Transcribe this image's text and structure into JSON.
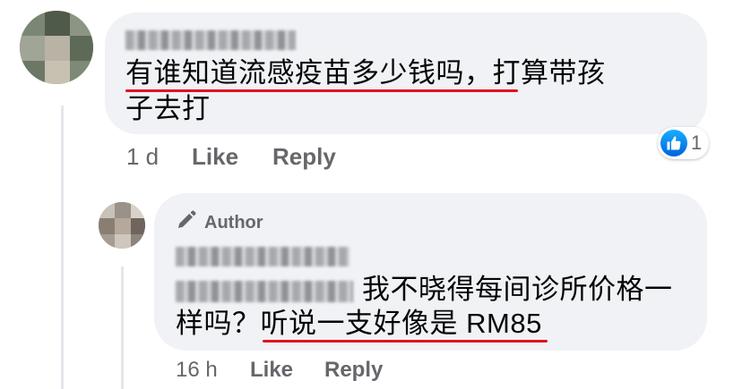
{
  "comment": {
    "author_name_redacted": "Chin Chong",
    "text_line1_underlined": "有谁知道流感疫苗多少钱吗",
    "text_line1_rest": "，打算带孩",
    "text_line2": "子去打",
    "timestamp": "1 d",
    "like_label": "Like",
    "reply_label": "Reply",
    "reaction_count": "1",
    "reaction_icon": "like-thumb-icon"
  },
  "reply": {
    "badge_label": "Author",
    "badge_icon": "pen-icon",
    "author_name_redacted": "Soo Kee Chong",
    "mention_redacted": "Chin Chong",
    "text_line1": "我不晓得每间诊所价格一",
    "text_line2_prefix": "样吗？",
    "text_line2_underlined": "听说一支好像是 RM85",
    "timestamp": "16 h",
    "like_label": "Like",
    "reply_label": "Reply"
  },
  "colors": {
    "bubble_bg": "#f0f2f5",
    "meta_text": "#65676b",
    "underline": "#e0141e",
    "like_blue": "#1877f2"
  }
}
